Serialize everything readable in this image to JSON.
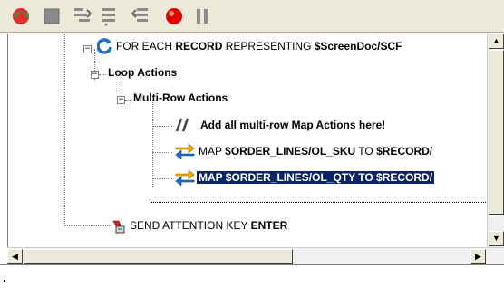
{
  "toolbar": {
    "buttons": [
      {
        "name": "run-icon",
        "color": "#2ea44f"
      },
      {
        "name": "stop-icon",
        "color": "#808080"
      },
      {
        "name": "step-into-icon",
        "color": "#808080"
      },
      {
        "name": "step-over-icon",
        "color": "#808080"
      },
      {
        "name": "step-out-icon",
        "color": "#808080"
      },
      {
        "name": "breakpoint-icon",
        "color": "#e00000"
      },
      {
        "name": "pause-icon",
        "color": "#808080"
      }
    ]
  },
  "tree": {
    "for_each": {
      "keyword": "FOR EACH",
      "record": "RECORD",
      "representing": "REPRESENTING",
      "path": "$ScreenDoc/SCF"
    },
    "loop_actions": "Loop Actions",
    "multi_row_actions": "Multi-Row Actions",
    "comment": "Add all multi-row Map Actions here!",
    "map1": {
      "keyword": "MAP",
      "source": "$ORDER_LINES/OL_SKU",
      "to": "TO",
      "target": "$RECORD/"
    },
    "map2": {
      "text": "MAP $ORDER_LINES/OL_QTY TO $RECORD/"
    },
    "send": {
      "text": "SEND ATTENTION KEY",
      "key": "ENTER"
    }
  },
  "colors": {
    "selection": "#0a246a",
    "accent": "#1f6fc2"
  }
}
